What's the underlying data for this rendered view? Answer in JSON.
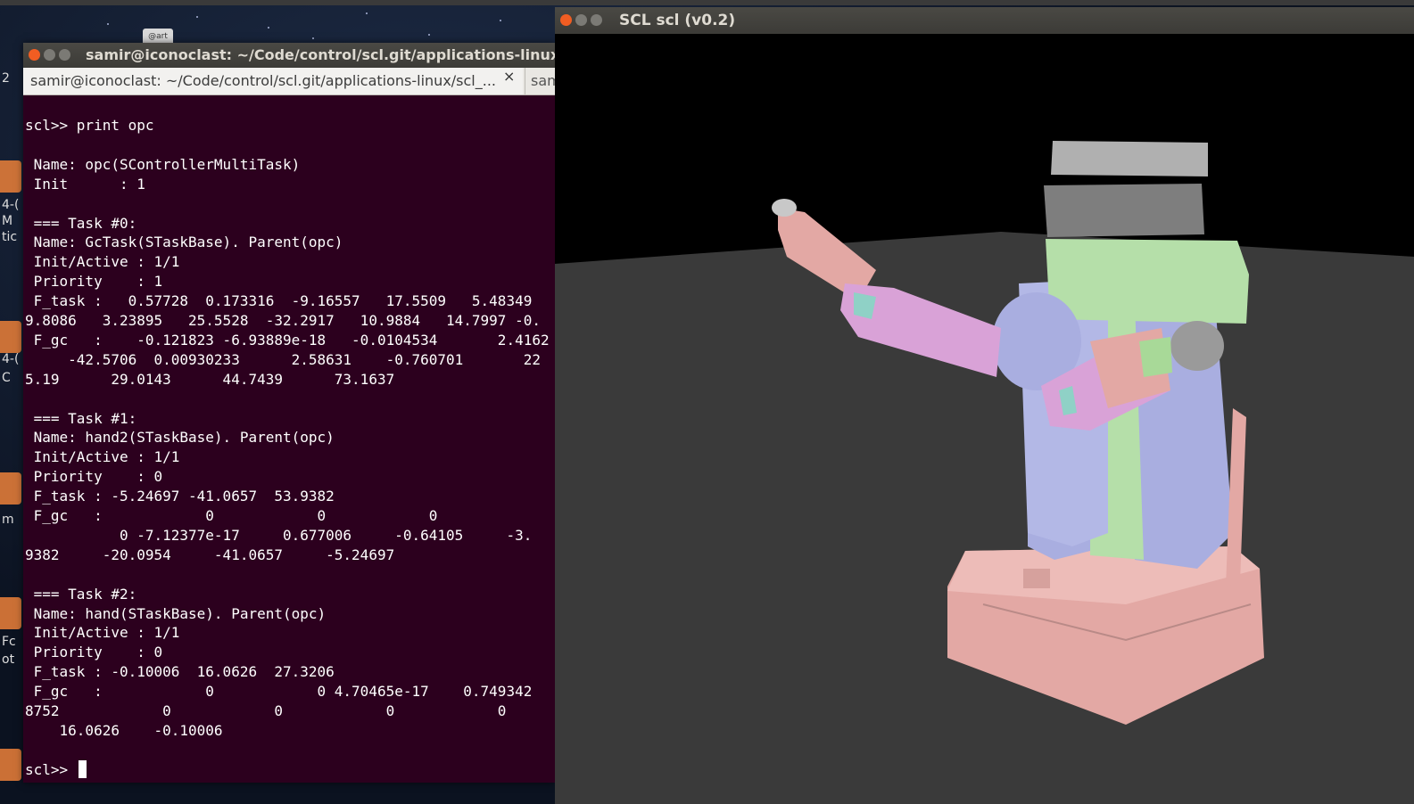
{
  "desktop": {
    "icon_label": "@art",
    "launcher_fragments": [
      "2",
      "4-(",
      "M",
      "tic",
      "m",
      "4-(",
      "C",
      "Fc",
      "ot"
    ]
  },
  "terminal": {
    "title": "samir@iconoclast: ~/Code/control/scl.git/applications-linux/scl_...",
    "tab_active_label": "samir@iconoclast: ~/Code/control/scl.git/applications-linux/scl_...",
    "tab_close_glyph": "×",
    "tab_second_label": "sam",
    "lines": [
      "scl>> print opc",
      "",
      " Name: opc(SControllerMultiTask)",
      " Init      : 1",
      "",
      " === Task #0:",
      " Name: GcTask(STaskBase). Parent(opc)",
      " Init/Active : 1/1",
      " Priority    : 1",
      " F_task :   0.57728  0.173316  -9.16557   17.5509   5.48349",
      "9.8086   3.23895   25.5528  -32.2917   10.9884   14.7997 -0.",
      " F_gc   :    -0.121823 -6.93889e-18   -0.0104534       2.4162",
      "     -42.5706  0.00930233      2.58631    -0.760701       22",
      "5.19      29.0143      44.7439      73.1637",
      "",
      " === Task #1:",
      " Name: hand2(STaskBase). Parent(opc)",
      " Init/Active : 1/1",
      " Priority    : 0",
      " F_task : -5.24697 -41.0657  53.9382",
      " F_gc   :            0            0            0",
      "           0 -7.12377e-17     0.677006     -0.64105     -3.",
      "9382     -20.0954     -41.0657     -5.24697",
      "",
      " === Task #2:",
      " Name: hand(STaskBase). Parent(opc)",
      " Init/Active : 1/1",
      " Priority    : 0",
      " F_task : -0.10006  16.0626  27.3206",
      " F_gc   :            0            0 4.70465e-17    0.749342",
      "8752            0            0            0            0",
      "    16.0626    -0.10006",
      "",
      "scl>> "
    ]
  },
  "scl_window": {
    "title": "SCL scl (v0.2)"
  },
  "colors": {
    "terminal_bg": "#2c001e",
    "terminal_text": "#ffffff",
    "viewport_bg": "#000000",
    "floor": "#3a3a3a",
    "robot_green": "#b5dfa9",
    "robot_purple": "#a9aee0",
    "robot_pink": "#e3a8a4",
    "robot_magenta": "#d9a2d7",
    "robot_gray": "#9a9a9a",
    "close_button": "#f15d22"
  }
}
